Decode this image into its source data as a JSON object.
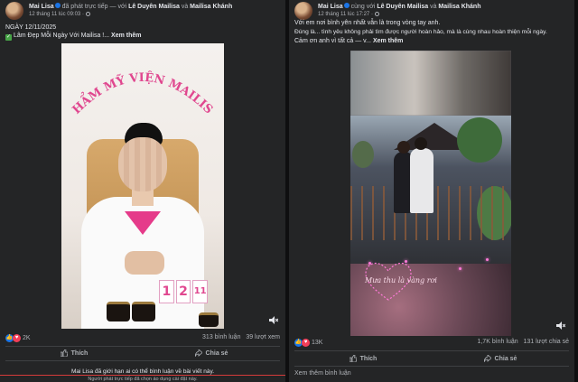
{
  "colors": {
    "card_bg": "#242526",
    "page_bg": "#0f0f10",
    "text": "#e4e6eb",
    "muted": "#b0b3b8",
    "like_blue": "#1b74e4",
    "love_red": "#f33e58",
    "brand_pink": "#e0478f"
  },
  "left_post": {
    "author": "Mai Lisa",
    "action_text": "đã phát trực tiếp — với",
    "tag1": "Lê Duyên Mailisa",
    "conj": "và",
    "tag2": "Mailisa Khánh",
    "timestamp": "12 tháng 11 lúc 09:03",
    "caption_line1": "NGÀY 12/11/2025",
    "caption_line2": "Lâm Đẹp Mỗi Ngày Với Mailisa !...",
    "see_more": "Xem thêm",
    "video_brand_text": "THẨM MỸ VIỆN MAILISA",
    "calendar_digits": [
      "1",
      "2",
      "11"
    ],
    "reaction_count": "2K",
    "comments": "313 bình luận",
    "views": "39 lượt xem",
    "like_label": "Thích",
    "share_label": "Chia sẻ",
    "restriction_text": "Mai Lisa đã giới hạn ai có thể bình luận về bài viết này.",
    "restriction_sub": "Người phát trực tiếp đã chọn áo dụng cài đặt này."
  },
  "right_post": {
    "author": "Mai Lisa",
    "action_text": "cùng với",
    "tag1": "Lê Duyên Mailisa",
    "conj": "và",
    "tag2": "Mailisa Khánh",
    "timestamp": "12 tháng 11 lúc 17:27",
    "caption_line1": "Với em nơi bình yên nhất vẫn là trong vòng tay anh.",
    "caption_line2": "Đúng là... tình yêu không phải tìm được người hoàn hảo, mà là cùng nhau hoàn thiện mỗi ngày.",
    "caption_line3": "Cảm ơn anh vì tất cả — v...",
    "see_more": "Xem thêm",
    "video_caption": "Mưa thu là vàng rơi",
    "reaction_count": "13K",
    "comments": "1,7K bình luận",
    "views": "131 lượt chia sẻ",
    "like_label": "Thích",
    "share_label": "Chia sẻ",
    "view_more_comments": "Xem thêm bình luận"
  }
}
